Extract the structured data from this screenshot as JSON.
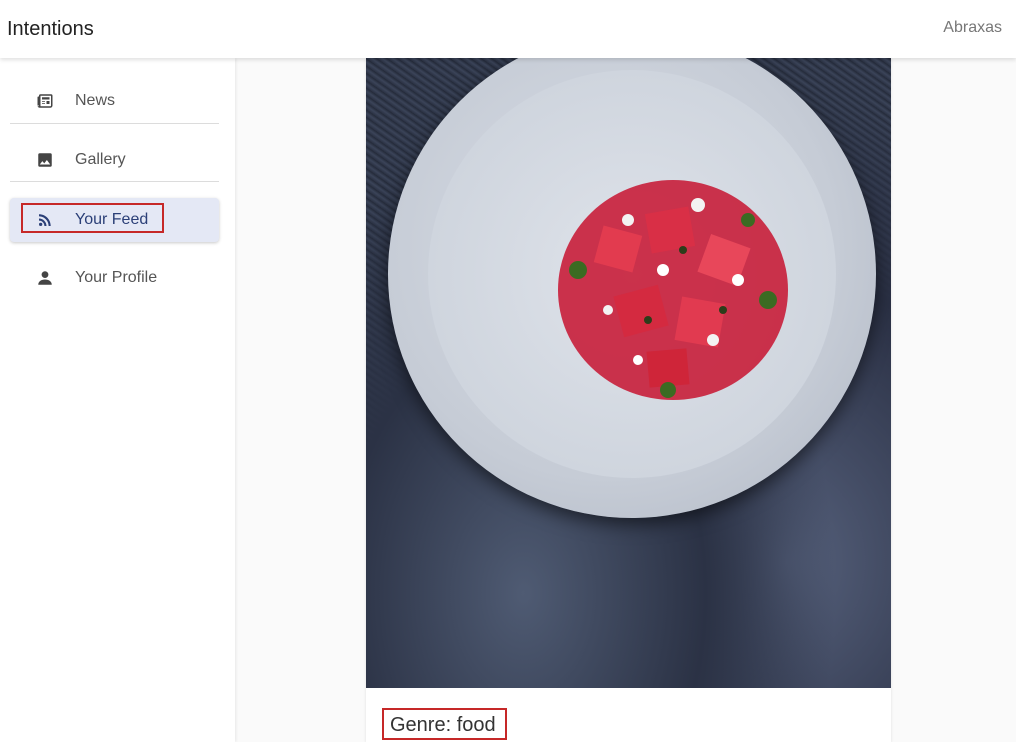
{
  "header": {
    "app_title": "Intentions",
    "user_name": "Abraxas"
  },
  "sidebar": {
    "items": [
      {
        "label": "News",
        "icon": "newspaper-icon"
      },
      {
        "label": "Gallery",
        "icon": "image-icon"
      },
      {
        "label": "Your Feed",
        "icon": "rss-feed-icon",
        "active": true
      },
      {
        "label": "Your Profile",
        "icon": "person-icon"
      }
    ]
  },
  "feed": {
    "post": {
      "image_description_icon": "food-photo",
      "caption": "Genre: food"
    }
  },
  "colors": {
    "active_bg": "#e4e8f5",
    "active_text": "#2b3f77",
    "highlight": "#c62828"
  }
}
